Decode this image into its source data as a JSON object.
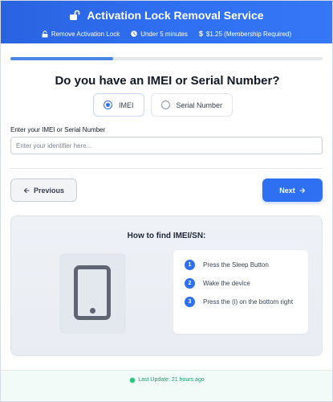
{
  "header": {
    "title": "Activation Lock Removal Service",
    "meta": [
      {
        "icon": "lock-icon",
        "label": "Remove Activation Lock"
      },
      {
        "icon": "clock-icon",
        "label": "Under 5 minutes"
      },
      {
        "icon": "dollar-icon",
        "label": "$1.25 (Membership Required)"
      }
    ]
  },
  "progress": {
    "fraction": 0.33
  },
  "question": "Do you have an IMEI or Serial Number?",
  "options": [
    {
      "label": "IMEI",
      "selected": true
    },
    {
      "label": "Serial Number",
      "selected": false
    }
  ],
  "field": {
    "label": "Enter your IMEI or Serial Number",
    "placeholder": "Enter your identifier here...",
    "value": ""
  },
  "nav": {
    "previous": "Previous",
    "next": "Next"
  },
  "guide": {
    "title": "How to find IMEI/SN:",
    "steps": [
      {
        "num": "1",
        "text": "Press the Sleep Button"
      },
      {
        "num": "2",
        "text": "Wake the device"
      },
      {
        "num": "3",
        "text": "Press the (i) on the bottom right"
      }
    ]
  },
  "footer": {
    "status": "Last Update: 21 hours ago"
  },
  "colors": {
    "primary": "#2f6ff2",
    "progress": "#4a86e8",
    "status": "#22c57e"
  }
}
